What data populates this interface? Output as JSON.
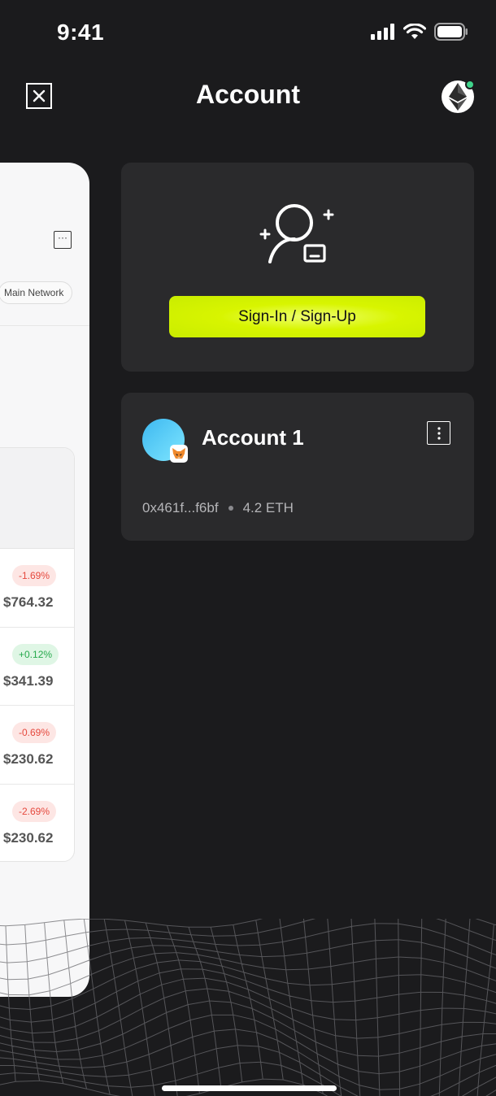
{
  "status_bar": {
    "time": "9:41"
  },
  "header": {
    "title": "Account"
  },
  "background_panel": {
    "network_label": "Main Network",
    "tokens": [
      {
        "change": "-1.69%",
        "direction": "neg",
        "price": "$764.32"
      },
      {
        "change": "+0.12%",
        "direction": "pos",
        "price": "$341.39"
      },
      {
        "change": "-0.69%",
        "direction": "neg",
        "price": "$230.62"
      },
      {
        "change": "-2.69%",
        "direction": "neg",
        "price": "$230.62"
      }
    ]
  },
  "signin": {
    "button_label": "Sign-In / Sign-Up"
  },
  "account": {
    "name": "Account 1",
    "address": "0x461f...f6bf",
    "balance": "4.2 ETH"
  },
  "colors": {
    "accent": "#d8f500",
    "background": "#1b1b1d",
    "card": "#2a2a2c",
    "online": "#3fd48b"
  }
}
